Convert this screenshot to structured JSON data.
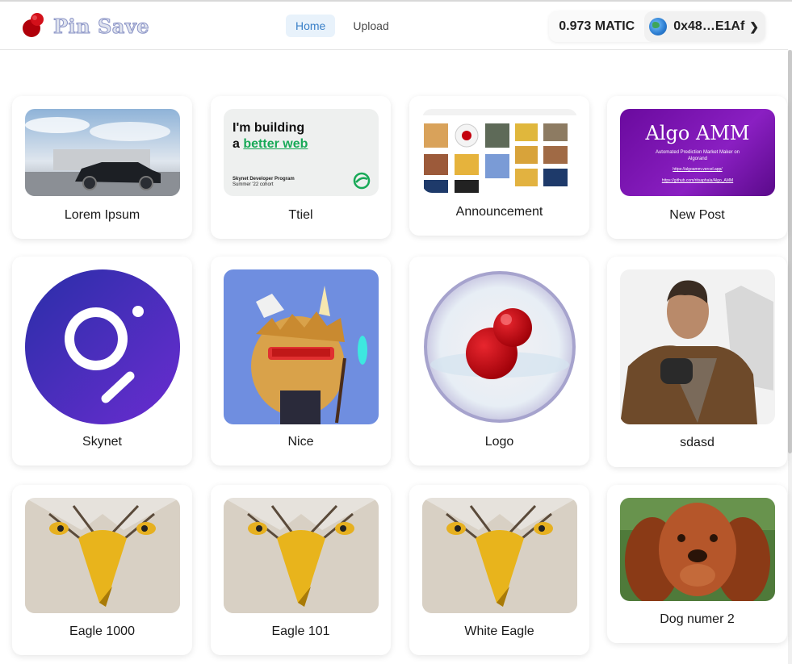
{
  "brand": {
    "name": "Pin Save"
  },
  "nav": {
    "items": [
      {
        "label": "Home",
        "active": true
      },
      {
        "label": "Upload",
        "active": false
      }
    ]
  },
  "wallet": {
    "balance": "0.973 MATIC",
    "account": "0x48…E1Af"
  },
  "colors": {
    "accent": "#3a80c8",
    "pin_red": "#c4000c"
  },
  "cards": [
    {
      "title": "Lorem Ipsum",
      "image": "black-car"
    },
    {
      "title": "Ttiel",
      "image": "skynet-developer-banner",
      "banner_line1": "I'm building",
      "banner_line2": "a",
      "banner_highlight": "better web",
      "banner_sub1": "Skynet Developer Program",
      "banner_sub2": "Summer '22 cohort"
    },
    {
      "title": "Announcement",
      "image": "gallery-screenshot"
    },
    {
      "title": "New Post",
      "image": "algo-amm-banner",
      "banner_title": "Algo AMM",
      "banner_sub": "Automated Prediction Market Maker on Algorand",
      "banner_link1": "https://algoamm.vercel.app/",
      "banner_link2": "https://github.com/ritsaphala/Algo_AMM"
    },
    {
      "title": "Skynet",
      "image": "skynet-logo"
    },
    {
      "title": "Nice",
      "image": "nft-monster"
    },
    {
      "title": "Logo",
      "image": "red-pin-logo"
    },
    {
      "title": "sdasd",
      "image": "man-in-jacket"
    },
    {
      "title": "Eagle 1000",
      "image": "eagle"
    },
    {
      "title": "Eagle 101",
      "image": "eagle"
    },
    {
      "title": "White Eagle",
      "image": "eagle"
    },
    {
      "title": "Dog numer 2",
      "image": "spaniel-dog"
    }
  ]
}
